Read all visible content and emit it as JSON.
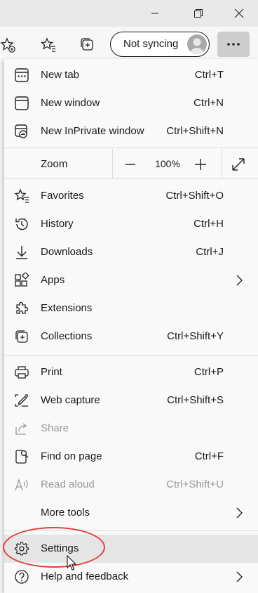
{
  "toolbar": {
    "sync_label": "Not syncing"
  },
  "menu": {
    "group1": [
      {
        "label": "New tab",
        "shortcut": "Ctrl+T",
        "icon": "new-tab-icon"
      },
      {
        "label": "New window",
        "shortcut": "Ctrl+N",
        "icon": "new-window-icon"
      },
      {
        "label": "New InPrivate window",
        "shortcut": "Ctrl+Shift+N",
        "icon": "inprivate-icon"
      }
    ],
    "zoom": {
      "label": "Zoom",
      "value": "100%"
    },
    "group2": [
      {
        "label": "Favorites",
        "shortcut": "Ctrl+Shift+O",
        "icon": "favorites-icon"
      },
      {
        "label": "History",
        "shortcut": "Ctrl+H",
        "icon": "history-icon"
      },
      {
        "label": "Downloads",
        "shortcut": "Ctrl+J",
        "icon": "download-icon"
      },
      {
        "label": "Apps",
        "shortcut": "",
        "icon": "apps-icon"
      },
      {
        "label": "Extensions",
        "shortcut": "",
        "icon": "extensions-icon"
      },
      {
        "label": "Collections",
        "shortcut": "Ctrl+Shift+Y",
        "icon": "collections-icon"
      }
    ],
    "group3": [
      {
        "label": "Print",
        "shortcut": "Ctrl+P",
        "icon": "print-icon"
      },
      {
        "label": "Web capture",
        "shortcut": "Ctrl+Shift+S",
        "icon": "web-capture-icon"
      },
      {
        "label": "Share",
        "shortcut": "",
        "icon": "share-icon"
      },
      {
        "label": "Find on page",
        "shortcut": "Ctrl+F",
        "icon": "find-icon"
      },
      {
        "label": "Read aloud",
        "shortcut": "Ctrl+Shift+U",
        "icon": "read-aloud-icon"
      },
      {
        "label": "More tools",
        "shortcut": "",
        "icon": ""
      }
    ],
    "group4": [
      {
        "label": "Settings",
        "shortcut": "",
        "icon": "gear-icon"
      },
      {
        "label": "Help and feedback",
        "shortcut": "",
        "icon": "help-icon"
      }
    ]
  },
  "colors": {
    "highlight_ring": "#e0403a",
    "menu_bg": "#f9f9f9",
    "hover_bg": "#e5e5e5"
  }
}
